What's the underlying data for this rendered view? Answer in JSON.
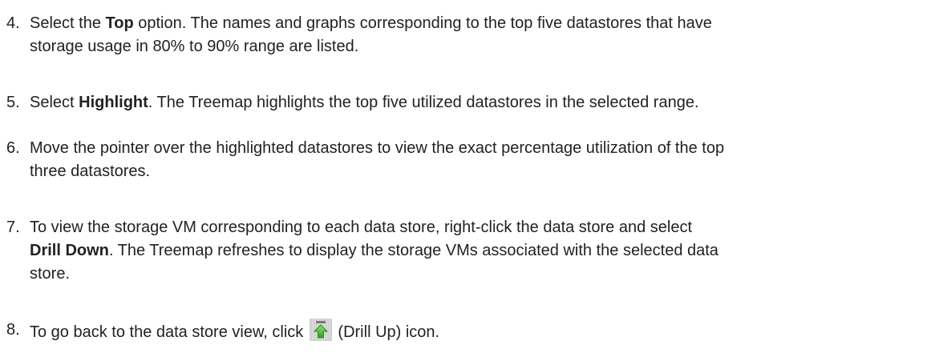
{
  "steps": [
    {
      "num": "4.",
      "t1": "Select the ",
      "b1": "Top",
      "t2": " option. The names and graphs corresponding to the top five datastores that have",
      "t3": "storage usage in 80% to 90% range are listed."
    },
    {
      "num": "5.",
      "t1": "Select ",
      "b1": "Highlight",
      "t2": ". The Treemap highlights the top five utilized datastores in the selected range."
    },
    {
      "num": "6.",
      "t1": "Move the pointer over the highlighted datastores to view the exact percentage utilization of the top",
      "t2": "three datastores."
    },
    {
      "num": "7.",
      "t1": "To view the storage VM corresponding to each data store, right-click the data store and select",
      "b1": "Drill Down",
      "t2": ". The Treemap refreshes to display the storage VMs associated with the selected data",
      "t3": "store."
    },
    {
      "num": "8.",
      "t1": "To go back to the data store view, click ",
      "t2": " (Drill Up) icon.",
      "icon": "drill-up-icon",
      "icon_colors": {
        "arrow": "#2fa31d",
        "arrow_light": "#7fd35e",
        "background": "#dcdcdc"
      }
    }
  ]
}
